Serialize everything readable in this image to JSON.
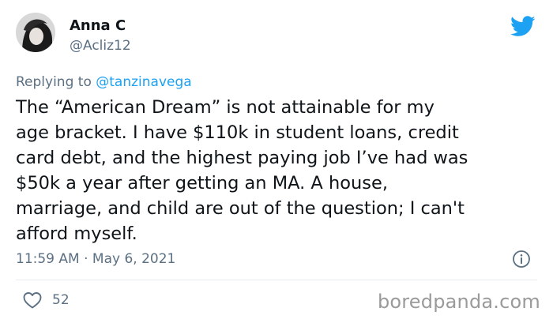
{
  "author": {
    "display_name": "Anna C",
    "handle": "@Acliz12"
  },
  "reply": {
    "prefix": "Replying to ",
    "to_handle": "@tanzinavega"
  },
  "tweet": {
    "lines": [
      "The “American Dream” is not attainable for my",
      "age bracket. I have $110k in student loans, credit",
      "card debt, and the highest paying job I’ve had was",
      "$50k a year after getting an MA. A house,",
      "marriage, and child are out of the question; I can't",
      "afford myself."
    ],
    "timestamp": "11:59 AM · May 6, 2021"
  },
  "engagement": {
    "likes": "52"
  },
  "watermark": "boredpanda.com",
  "icons": {
    "brand": "twitter-bird-icon",
    "info": "info-icon",
    "like": "heart-icon"
  },
  "colors": {
    "text": "#0f1419",
    "secondary": "#5b7083",
    "link": "#1da1f2",
    "brand": "#1da1f2",
    "divider": "#e6ecf0"
  }
}
